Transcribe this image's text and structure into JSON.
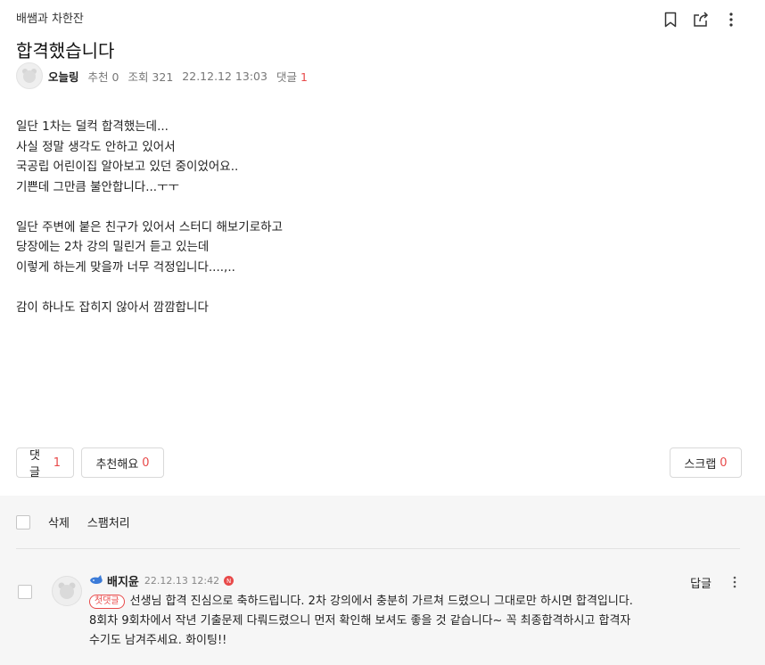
{
  "post": {
    "category": "배쌤과 차한잔",
    "title": "합격했습니다",
    "author": "오늘링",
    "recommend_label": "추천 0",
    "views_label": "조회 321",
    "datetime": "22.12.12 13:03",
    "comments_label": "댓글",
    "comments_count": "1",
    "body_lines": [
      "일단 1차는 덜컥 합격했는데...",
      "사실 정말 생각도 안하고 있어서",
      "국공립 어린이집 알아보고 있던 중이었어요..",
      "기쁜데 그만큼 불안합니다...ㅜㅜ",
      "",
      "일단 주변에 붙은 친구가 있어서 스터디 해보기로하고",
      "당장에는 2차 강의 밀린거 듣고 있는데",
      "이렇게 하는게 맞을까 너무 걱정입니다....,..",
      "",
      "감이 하나도 잡히지 않아서 깜깜합니다"
    ]
  },
  "actions": {
    "comment_label": "댓글",
    "comment_count": "1",
    "recommend_label": "추천해요",
    "recommend_count": "0",
    "scrap_label": "스크랩",
    "scrap_count": "0"
  },
  "toolbar": {
    "delete_label": "삭제",
    "spam_label": "스팸처리"
  },
  "comment": {
    "author": "배지윤",
    "date": "22.12.13 12:42",
    "new_marker": "N",
    "badge": "첫댓글",
    "text": "선생님 합격 진심으로 축하드립니다. 2차 강의에서 충분히 가르쳐 드렸으니 그대로만 하시면 합격입니다. 8회차 9회차에서 작년 기출문제 다뤄드렸으니 먼저 확인해 보셔도 좋을 것 같습니다~ 꼭 최종합격하시고 합격자 수기도 남겨주세요. 화이팅!!",
    "reply_label": "답글"
  },
  "colors": {
    "accent_red": "#e84a4a",
    "comment_bg": "#f6f6f6"
  },
  "icons": [
    "bookmark-icon",
    "share-icon",
    "more-vertical-icon",
    "profile-default-icon",
    "whale-level-icon"
  ]
}
